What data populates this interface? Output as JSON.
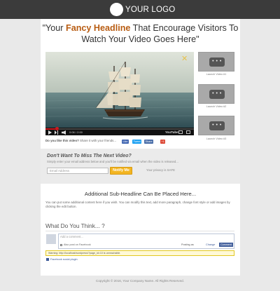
{
  "header": {
    "logo_text": "YOUR LOGO"
  },
  "headline": {
    "before": "\"Your ",
    "accent": "Fancy Headline",
    "after": " That Encourage Visitors To Watch Your Video Goes Here\""
  },
  "video": {
    "time": "0:06 / 2:00",
    "yt_label": "YouTube",
    "progress": 0.08
  },
  "launch_videos": [
    "Launch Video #1",
    "Launch Video #2",
    "Launch Video #3"
  ],
  "thumb_dots": "• • •",
  "social": {
    "prompt": "Do you like this video?",
    "prompt_rest": " Share it with your friends...",
    "like_label": "Like",
    "tweet_label": "Tweet",
    "share_label": "Share",
    "plus_label": "+1"
  },
  "optin": {
    "title": "Don't Want To Miss The Next Video?",
    "text": "Simply enter your email address below and you'll be notified via email when the video is released...",
    "email_placeholder": "Email Address",
    "button": "Notify Me",
    "privacy": "Your privacy is SAFE"
  },
  "content": {
    "sub_headline": "Additional Sub-Headline Can Be Placed Here...",
    "body": "You can put some additional content here if you wish. You can modify this text, add more paragraph, change font style or add images by clicking the edit button."
  },
  "comments": {
    "title": "What Do You Think... ?",
    "placeholder": "Add a comment...",
    "also_post": "Also post on Facebook",
    "posting_as": "Posting as",
    "change": "Change",
    "comment_button": "Comment",
    "warning": "Warning: http://localhost/wordpress/?page_id=10 is unreachable.",
    "plugin": "Facebook social plugin"
  },
  "footer": {
    "copyright": "Copyright © 2016, Your Company Name. All Rights Reserved."
  },
  "colors": {
    "topbar": "#3b3b3b",
    "accent": "#b85c12",
    "notify_button": "#f3b522",
    "facebook": "#3b5998",
    "progress": "#cc181e"
  }
}
